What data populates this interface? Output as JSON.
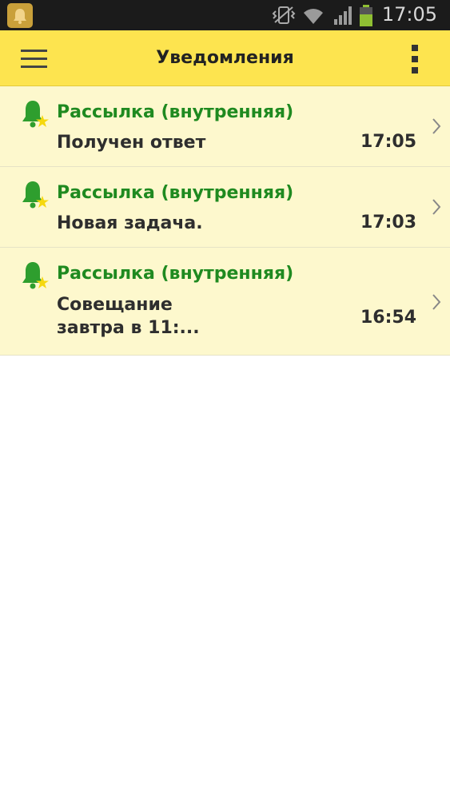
{
  "status_bar": {
    "time": "17:05"
  },
  "app_bar": {
    "title": "Уведомления",
    "menu_icon": "hamburger-menu-icon",
    "overflow_icon": "more-vertical-icon"
  },
  "colors": {
    "app_bar": "#fde44f",
    "list_background": "#fdf8cd",
    "sender_text": "#1f8a20",
    "bell": "#2e9e2e",
    "star": "#f5d80f"
  },
  "notifications": [
    {
      "sender": "Рассылка (внутренняя)",
      "text": "Получен ответ",
      "time": "17:05",
      "icon": "bell-star-icon"
    },
    {
      "sender": "Рассылка (внутренняя)",
      "text": "Новая задача.",
      "time": "17:03",
      "icon": "bell-star-icon"
    },
    {
      "sender": "Рассылка (внутренняя)",
      "text": "Совещание\nзавтра в 11:...",
      "time": "16:54",
      "icon": "bell-star-icon"
    }
  ]
}
